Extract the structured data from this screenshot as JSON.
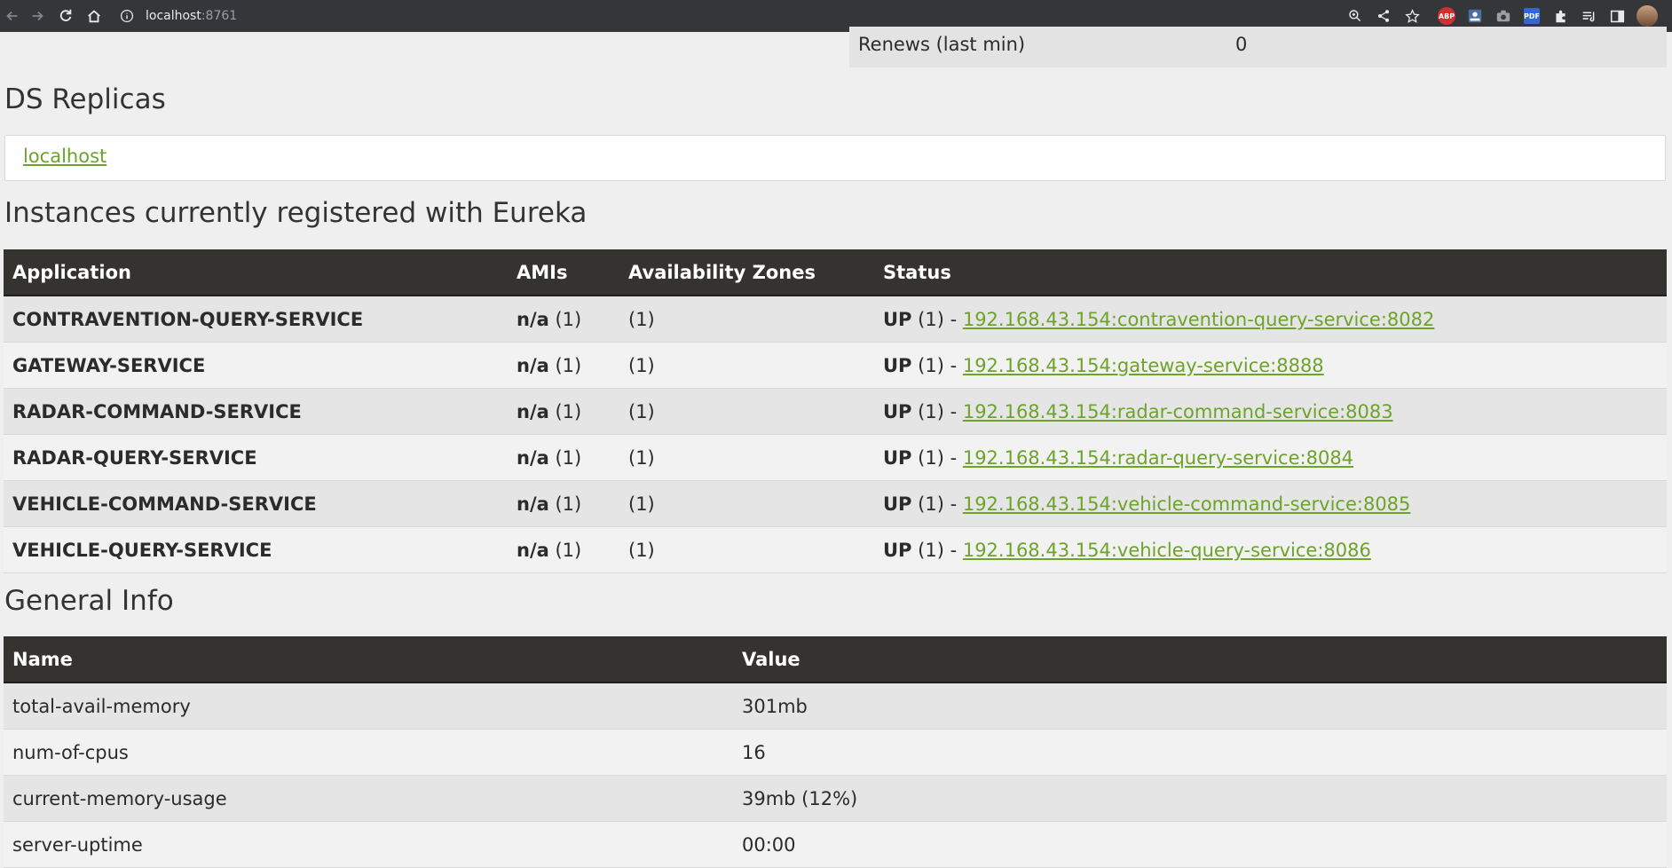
{
  "browser": {
    "url_host": "localhost",
    "url_port": ":8761"
  },
  "renews": {
    "label": "Renews (last min)",
    "value": "0"
  },
  "ds_replicas": {
    "title": "DS Replicas",
    "link": "localhost"
  },
  "instances": {
    "title": "Instances currently registered with Eureka",
    "headers": [
      "Application",
      "AMIs",
      "Availability Zones",
      "Status"
    ],
    "rows": [
      {
        "app": "CONTRAVENTION-QUERY-SERVICE",
        "ami_bold": "n/a",
        "ami_count": "(1)",
        "zones": "(1)",
        "status_bold": "UP",
        "status_count": "(1) -",
        "link": "192.168.43.154:contravention-query-service:8082"
      },
      {
        "app": "GATEWAY-SERVICE",
        "ami_bold": "n/a",
        "ami_count": "(1)",
        "zones": "(1)",
        "status_bold": "UP",
        "status_count": "(1) -",
        "link": "192.168.43.154:gateway-service:8888"
      },
      {
        "app": "RADAR-COMMAND-SERVICE",
        "ami_bold": "n/a",
        "ami_count": "(1)",
        "zones": "(1)",
        "status_bold": "UP",
        "status_count": "(1) -",
        "link": "192.168.43.154:radar-command-service:8083"
      },
      {
        "app": "RADAR-QUERY-SERVICE",
        "ami_bold": "n/a",
        "ami_count": "(1)",
        "zones": "(1)",
        "status_bold": "UP",
        "status_count": "(1) -",
        "link": "192.168.43.154:radar-query-service:8084"
      },
      {
        "app": "VEHICLE-COMMAND-SERVICE",
        "ami_bold": "n/a",
        "ami_count": "(1)",
        "zones": "(1)",
        "status_bold": "UP",
        "status_count": "(1) -",
        "link": "192.168.43.154:vehicle-command-service:8085"
      },
      {
        "app": "VEHICLE-QUERY-SERVICE",
        "ami_bold": "n/a",
        "ami_count": "(1)",
        "zones": "(1)",
        "status_bold": "UP",
        "status_count": "(1) -",
        "link": "192.168.43.154:vehicle-query-service:8086"
      }
    ]
  },
  "general_info": {
    "title": "General Info",
    "headers": [
      "Name",
      "Value"
    ],
    "rows": [
      {
        "name": "total-avail-memory",
        "value": "301mb"
      },
      {
        "name": "num-of-cpus",
        "value": "16"
      },
      {
        "name": "current-memory-usage",
        "value": "39mb (12%)"
      },
      {
        "name": "server-uptime",
        "value": "00:00"
      }
    ]
  },
  "colors": {
    "link": "#6da32a",
    "header_bg": "#353330"
  }
}
